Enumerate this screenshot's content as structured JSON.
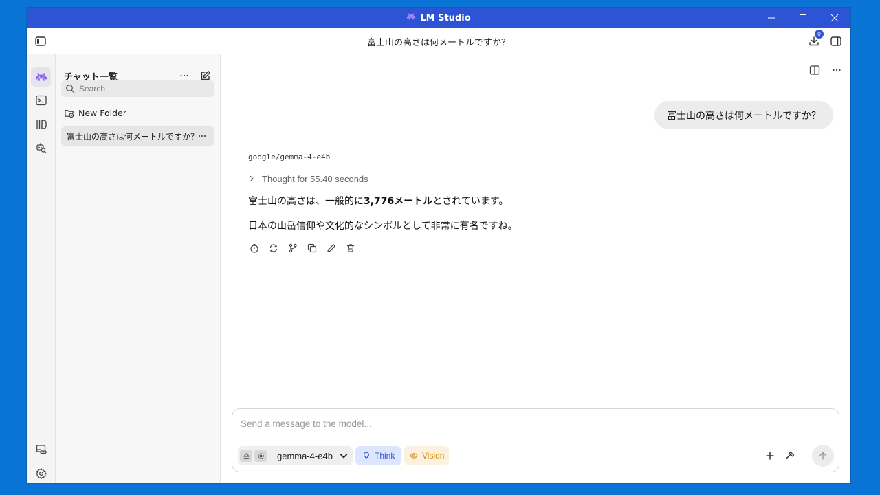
{
  "window": {
    "title": "LM Studio"
  },
  "header": {
    "chat_title": "富士山の高さは何メートルですか？",
    "downloads_badge": "0"
  },
  "rail": {
    "items": [
      {
        "icon": "chat-icon",
        "active": true
      },
      {
        "icon": "terminal-icon"
      },
      {
        "icon": "library-icon"
      },
      {
        "icon": "model-search-icon"
      }
    ],
    "bottom": [
      {
        "icon": "link-icon"
      },
      {
        "icon": "gear-icon"
      }
    ]
  },
  "sidebar": {
    "title": "チャット一覧",
    "search_placeholder": "Search",
    "new_folder_label": "New Folder",
    "chats": [
      {
        "title": "富士山の高さは何メートルですか？",
        "selected": true
      }
    ]
  },
  "conversation": {
    "user_message": "富士山の高さは何メートルですか？",
    "model_id": "google/gemma-4-e4b",
    "thought_label": "Thought for 55.40 seconds",
    "answer_line1_before": "富士山の高さは、一般的に",
    "answer_line1_bold": "3,776メートル",
    "answer_line1_after": "とされています。",
    "answer_line2": "日本の山岳信仰や文化的なシンボルとして非常に有名ですね。",
    "action_icons": [
      "timer-icon",
      "regenerate-icon",
      "branch-icon",
      "copy-icon",
      "edit-icon",
      "delete-icon"
    ]
  },
  "composer": {
    "placeholder": "Send a message to the model...",
    "model_name": "gemma-4-e4b",
    "think_label": "Think",
    "vision_label": "Vision"
  },
  "colors": {
    "titlebar": "#2c54d5",
    "desktop": "#0a74d6",
    "think_text": "#3158d4",
    "vision_text": "#d38a12"
  }
}
